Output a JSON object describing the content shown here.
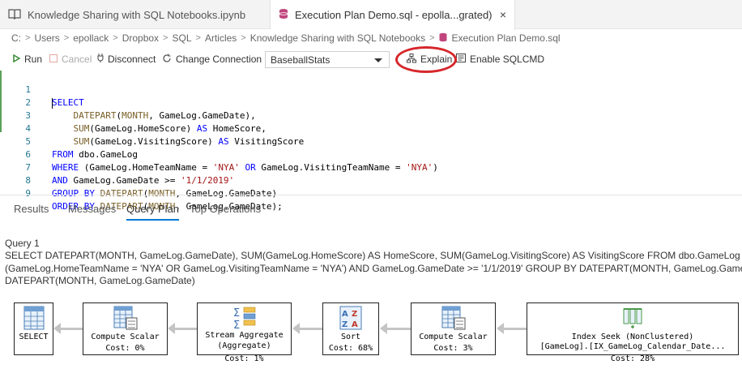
{
  "tabs": [
    {
      "label": "Knowledge Sharing with SQL Notebooks.ipynb"
    },
    {
      "label": "Execution Plan Demo.sql - epolla...grated)",
      "close": "×"
    }
  ],
  "breadcrumb": {
    "items": [
      "C:",
      "Users",
      "epollack",
      "Dropbox",
      "SQL",
      "Articles",
      "Knowledge Sharing with SQL Notebooks",
      "Execution Plan Demo.sql"
    ],
    "separator": ">"
  },
  "toolbar": {
    "run": "Run",
    "cancel": "Cancel",
    "disconnect": "Disconnect",
    "change_connection": "Change Connection",
    "database": "BaseballStats",
    "explain": "Explain",
    "enable_sqlcmd": "Enable SQLCMD"
  },
  "editor": {
    "line_numbers": [
      "1",
      "2",
      "3",
      "4",
      "5",
      "6",
      "7",
      "8",
      "9"
    ]
  },
  "results_tabs": [
    "Results",
    "Messages",
    "Query Plan",
    "Top Operations"
  ],
  "active_results_tab": "Query Plan",
  "query": {
    "title": "Query 1",
    "lines": [
      "SELECT DATEPART(MONTH, GameLog.GameDate), SUM(GameLog.HomeScore) AS HomeScore, SUM(GameLog.VisitingScore) AS VisitingScore FROM dbo.GameLog WHERE",
      "(GameLog.HomeTeamName = 'NYA' OR GameLog.VisitingTeamName = 'NYA') AND GameLog.GameDate >= '1/1/2019' GROUP BY DATEPART(MONTH, GameLog.GameDate",
      "DATEPART(MONTH, GameLog.GameDate)"
    ]
  },
  "plan_nodes": [
    {
      "label": "SELECT",
      "cost": ""
    },
    {
      "label": "Compute Scalar",
      "cost": "Cost: 0%"
    },
    {
      "label": "Stream Aggregate",
      "sub": "(Aggregate)",
      "cost": "Cost: 1%"
    },
    {
      "label": "Sort",
      "cost": "Cost: 68%"
    },
    {
      "label": "Compute Scalar",
      "cost": "Cost: 3%"
    },
    {
      "label": "Index Seek (NonClustered)",
      "sub": "[GameLog].[IX_GameLog_Calendar_Date...",
      "cost": "Cost: 28%"
    }
  ],
  "colors": {
    "accent": "#0078d4",
    "highlight_ring": "#d6262b",
    "keyword": "#0000ff",
    "function": "#795e26",
    "string": "#a31515",
    "line_number": "#237893",
    "run_icon": "#388a34"
  }
}
